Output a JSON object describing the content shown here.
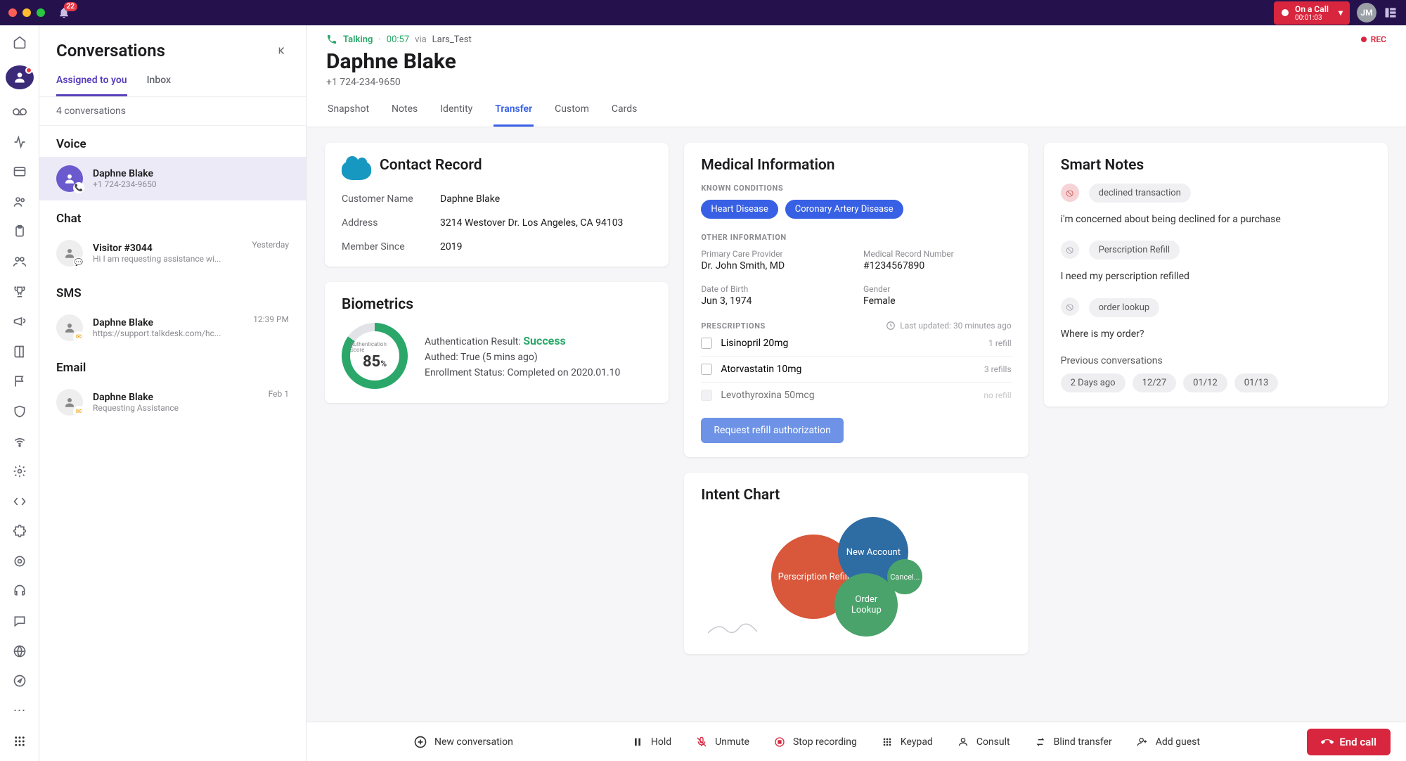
{
  "topbar": {
    "bell_badge": "22",
    "call_status": "On a Call",
    "call_timer": "00:01:03",
    "user_initials": "JM"
  },
  "sidebar": {
    "title": "Conversations",
    "tabs": {
      "assigned": "Assigned to you",
      "inbox": "Inbox"
    },
    "count": "4 conversations",
    "sections": {
      "voice": "Voice",
      "chat": "Chat",
      "sms": "SMS",
      "email": "Email"
    },
    "voice_item": {
      "name": "Daphne Blake",
      "sub": "+1 724-234-9650"
    },
    "chat_item": {
      "name": "Visitor #3044",
      "sub": "Hi I am requesting assistance wi...",
      "time": "Yesterday"
    },
    "sms_item": {
      "name": "Daphne Blake",
      "sub": "https://support.talkdesk.com/hc...",
      "time": "12:39 PM"
    },
    "email_item": {
      "name": "Daphne Blake",
      "sub": "Requesting Assistance",
      "time": "Feb 1"
    }
  },
  "header": {
    "status": "Talking",
    "duration": "00:57",
    "via_label": "via",
    "via_name": "Lars_Test",
    "rec": "REC",
    "contact_name": "Daphne Blake",
    "contact_phone": "+1 724-234-9650",
    "tabs": {
      "snapshot": "Snapshot",
      "notes": "Notes",
      "identity": "Identity",
      "transfer": "Transfer",
      "custom": "Custom",
      "cards": "Cards"
    }
  },
  "contact_record": {
    "title": "Contact Record",
    "customer_name_k": "Customer Name",
    "customer_name_v": "Daphne Blake",
    "address_k": "Address",
    "address_v": "3214 Westover Dr. Los Angeles, CA 94103",
    "member_since_k": "Member Since",
    "member_since_v": "2019"
  },
  "biometrics": {
    "title": "Biometrics",
    "score_label": "Authentication Score",
    "score": "85",
    "score_suffix": "%",
    "auth_result_label": "Authentication Result:",
    "auth_result_value": "Success",
    "authed": "Authed: True (5 mins ago)",
    "enrollment": "Enrollment Status: Completed on 2020.01.10"
  },
  "medical": {
    "title": "Medical Information",
    "known_h": "KNOWN CONDITIONS",
    "cond1": "Heart Disease",
    "cond2": "Coronary Artery Disease",
    "other_h": "OTHER INFORMATION",
    "pcp_k": "Primary Care Provider",
    "pcp_v": "Dr. John Smith, MD",
    "mrn_k": "Medical Record Number",
    "mrn_v": "#1234567890",
    "dob_k": "Date of Birth",
    "dob_v": "Jun 3, 1974",
    "gender_k": "Gender",
    "gender_v": "Female",
    "presc_h": "PRESCRIPTIONS",
    "updated": "Last updated: 30 minutes ago",
    "p1": "Lisinopril 20mg",
    "p1r": "1 refill",
    "p2": "Atorvastatin 10mg",
    "p2r": "3 refills",
    "p3": "Levothyroxina 50mcg",
    "p3r": "no refill",
    "button": "Request refill authorization"
  },
  "smart": {
    "title": "Smart Notes",
    "tag1": "declined transaction",
    "note1": "i'm concerned about being declined for a purchase",
    "tag2": "Perscription Refill",
    "note2": "I need my perscription refilled",
    "tag3": "order lookup",
    "note3": "Where is my order?",
    "prev_h": "Previous conversations",
    "d1": "2 Days ago",
    "d2": "12/27",
    "d3": "01/12",
    "d4": "01/13"
  },
  "intent": {
    "title": "Intent Chart",
    "b1": "Perscription Refill",
    "b2": "New Account",
    "b3": "Order Lookup",
    "b4": "Cancel..."
  },
  "footer": {
    "new": "New conversation",
    "hold": "Hold",
    "unmute": "Unmute",
    "stop": "Stop recording",
    "keypad": "Keypad",
    "consult": "Consult",
    "blind": "Blind transfer",
    "guest": "Add guest",
    "end": "End call"
  },
  "chart_data": {
    "type": "bubble",
    "title": "Intent Chart",
    "series": [
      {
        "name": "Perscription Refill",
        "value": 45,
        "color": "#d9573b"
      },
      {
        "name": "New Account",
        "value": 35,
        "color": "#2e6ca4"
      },
      {
        "name": "Order Lookup",
        "value": 30,
        "color": "#4aa36a"
      },
      {
        "name": "Cancel...",
        "value": 12,
        "color": "#4aa36a"
      }
    ]
  }
}
